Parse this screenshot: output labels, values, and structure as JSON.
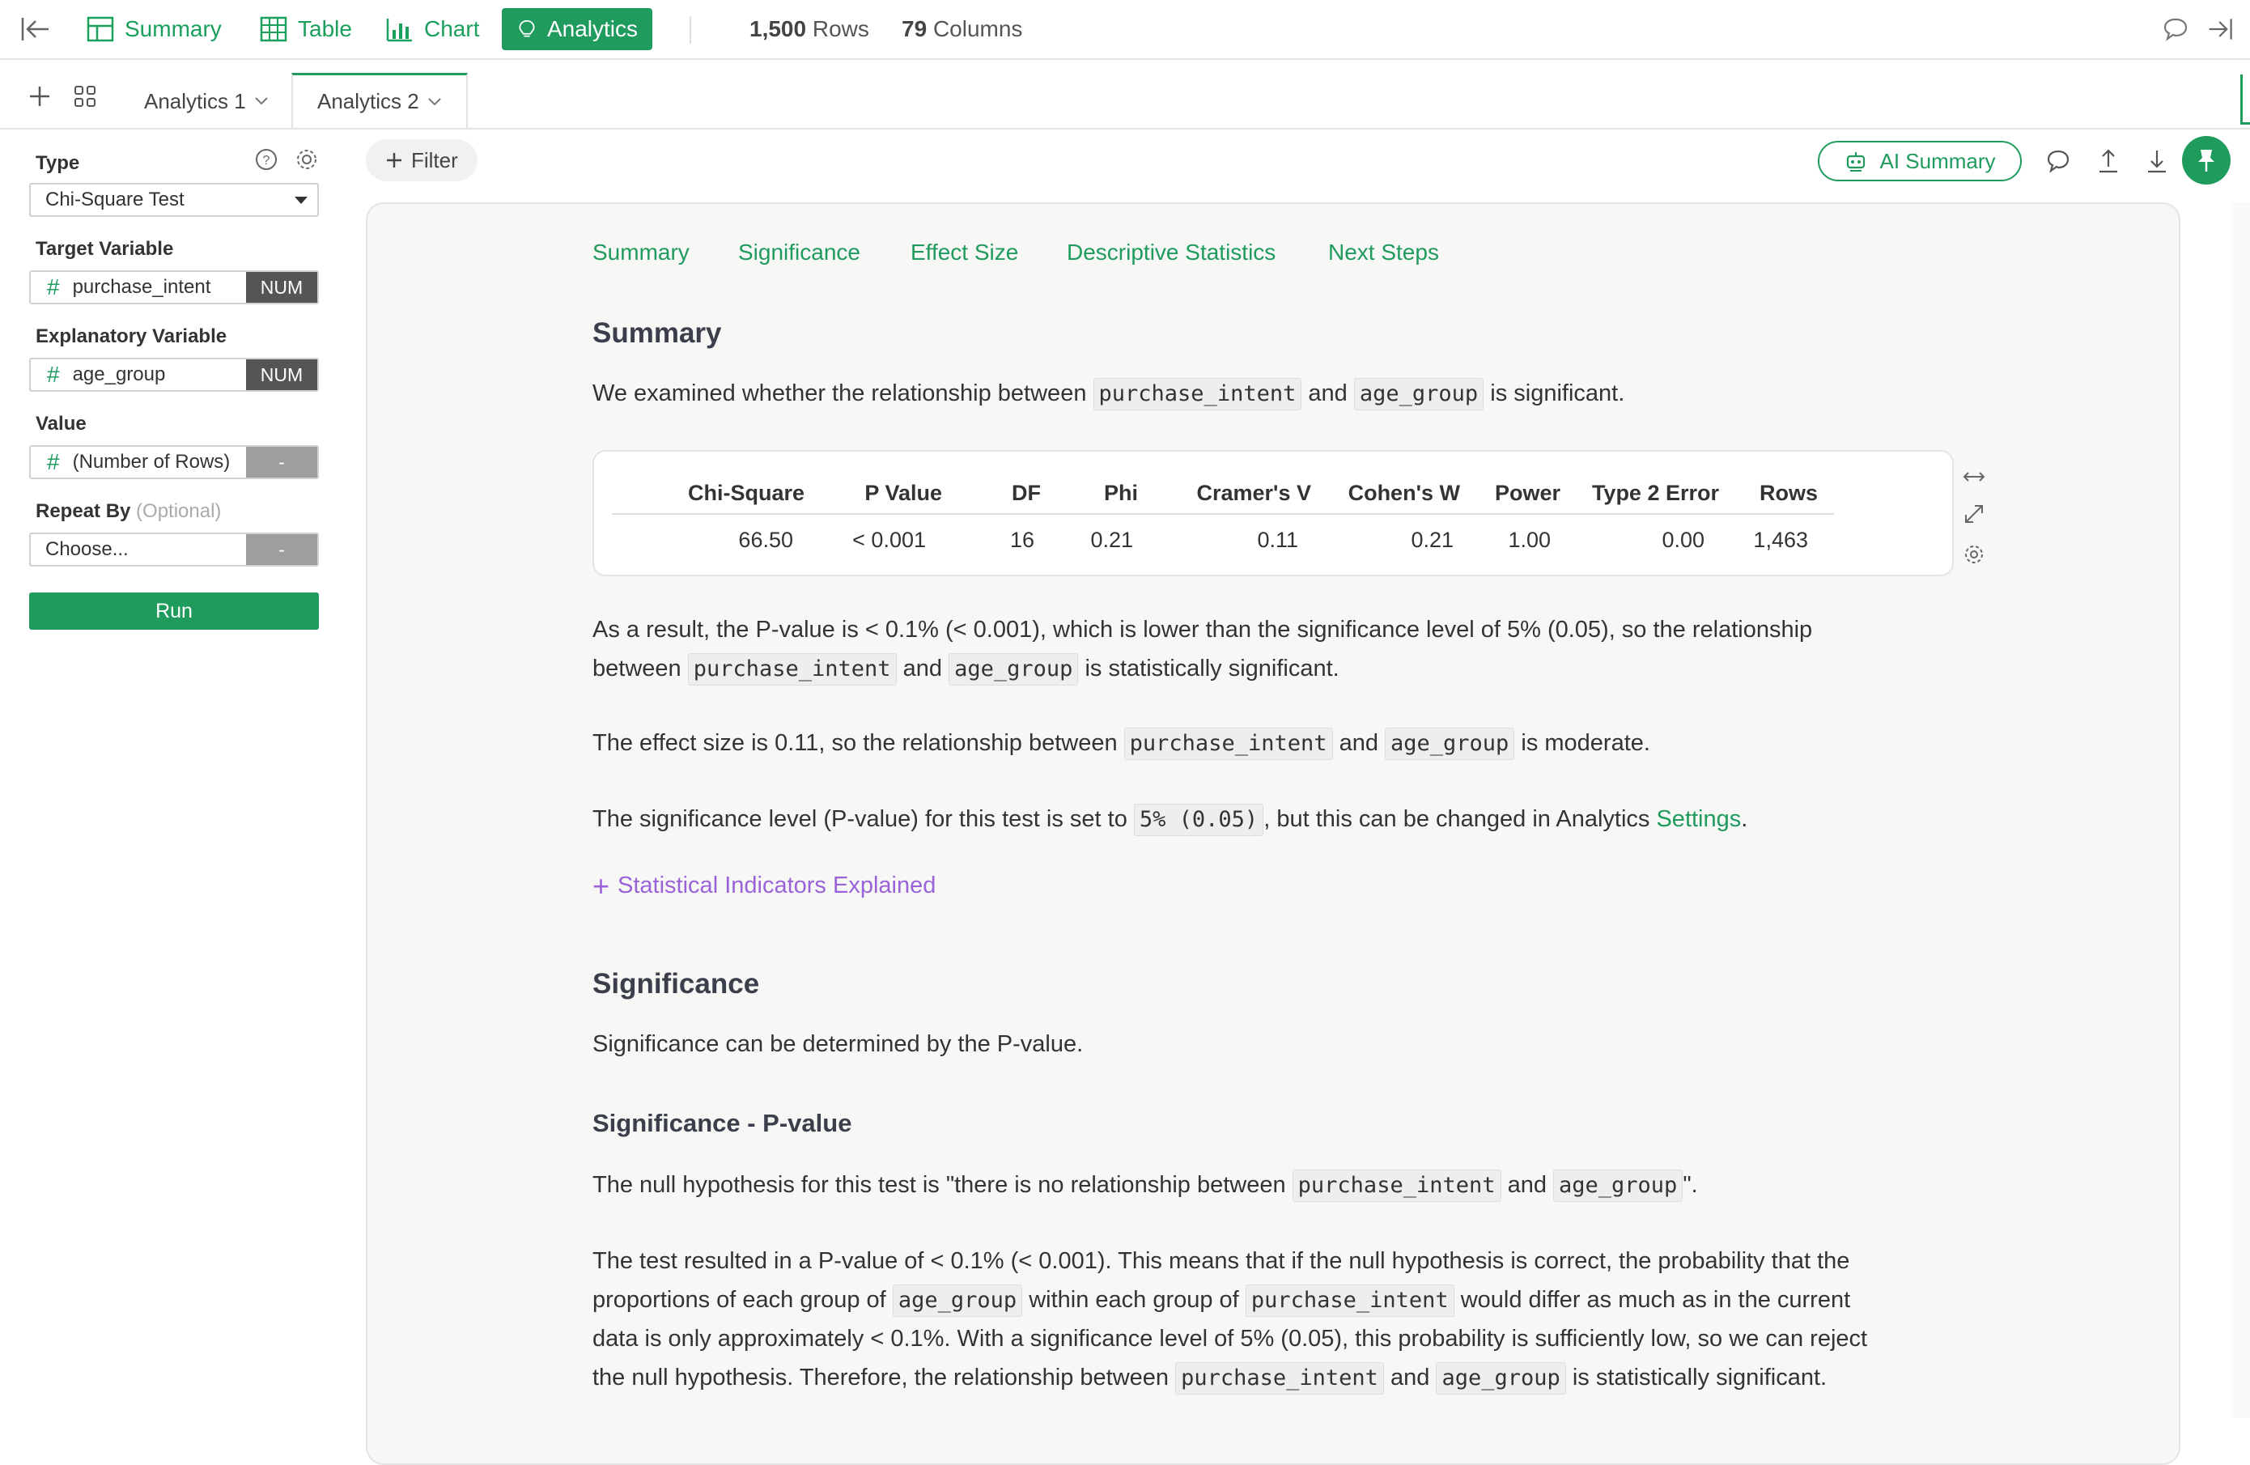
{
  "topbar": {
    "nav": [
      {
        "label": "Summary",
        "icon": "summary-grid-icon",
        "active": false
      },
      {
        "label": "Table",
        "icon": "table-icon",
        "active": false
      },
      {
        "label": "Chart",
        "icon": "bar-chart-icon",
        "active": false
      },
      {
        "label": "Analytics",
        "icon": "lightbulb-icon",
        "active": true
      }
    ],
    "rows_count": "1,500",
    "rows_label": "Rows",
    "cols_count": "79",
    "cols_label": "Columns"
  },
  "tabs": [
    {
      "label": "Analytics 1",
      "active": false
    },
    {
      "label": "Analytics 2",
      "active": true
    }
  ],
  "left_panel": {
    "type_label": "Type",
    "type_value": "Chi-Square Test",
    "target_label": "Target Variable",
    "target_value": "purchase_intent",
    "target_tag": "NUM",
    "explanatory_label": "Explanatory Variable",
    "explanatory_value": "age_group",
    "explanatory_tag": "NUM",
    "value_label": "Value",
    "value_value": "(Number of Rows)",
    "value_tag": "-",
    "repeat_label": "Repeat By",
    "repeat_optional": "(Optional)",
    "repeat_value": "Choose...",
    "repeat_tag": "-",
    "run_label": "Run"
  },
  "toolbar": {
    "filter_label": "Filter",
    "ai_summary_label": "AI Summary"
  },
  "sections_nav": [
    "Summary",
    "Significance",
    "Effect Size",
    "Descriptive Statistics",
    "Next Steps"
  ],
  "summary": {
    "heading": "Summary",
    "intro_a": "We examined whether the relationship between",
    "intro_b": "and",
    "intro_c": "is significant.",
    "var1": "purchase_intent",
    "var2": "age_group",
    "table": {
      "headers": [
        "Chi-Square",
        "P Value",
        "DF",
        "Phi",
        "Cramer's V",
        "Cohen's W",
        "Power",
        "Type 2 Error",
        "Rows"
      ],
      "values": [
        "66.50",
        "< 0.001",
        "16",
        "0.21",
        "0.11",
        "0.21",
        "1.00",
        "0.00",
        "1,463"
      ]
    },
    "result_a": "As a result, the P-value is < 0.1% (< 0.001), which is lower than the significance level of 5% (0.05), so the relationship",
    "result_b": "between",
    "result_c": "and",
    "result_d": "is statistically significant.",
    "effect_a": "The effect size is 0.11, so the relationship between",
    "effect_b": "and",
    "effect_c": "is moderate.",
    "sig_a": "The significance level (P-value) for this test is set to",
    "sig_code": "5% (0.05)",
    "sig_b": ", but this can be changed in Analytics",
    "sig_link": "Settings",
    "sig_end": ".",
    "explained_label": "Statistical Indicators Explained"
  },
  "significance": {
    "heading": "Significance",
    "intro": "Significance can be determined by the P-value.",
    "sub_heading": "Significance - P-value",
    "null_a": "The null hypothesis for this test is \"there is no relationship between",
    "null_b": "and",
    "null_c": "\".",
    "test_a": "The test resulted in a P-value of < 0.1% (< 0.001). This means that if the null hypothesis is correct, the probability that the",
    "test_b": "proportions of each group of",
    "test_c": "within each group of",
    "test_d": "would differ as much as in the current",
    "test_e": "data is only approximately < 0.1%. With a significance level of 5% (0.05), this probability is sufficiently low, so we can reject",
    "test_f": "the null hypothesis. Therefore, the relationship between",
    "test_g": "and",
    "test_h": "is statistically significant."
  },
  "colors": {
    "accent": "#1f9b5e",
    "purple_link": "#9a63d9"
  }
}
